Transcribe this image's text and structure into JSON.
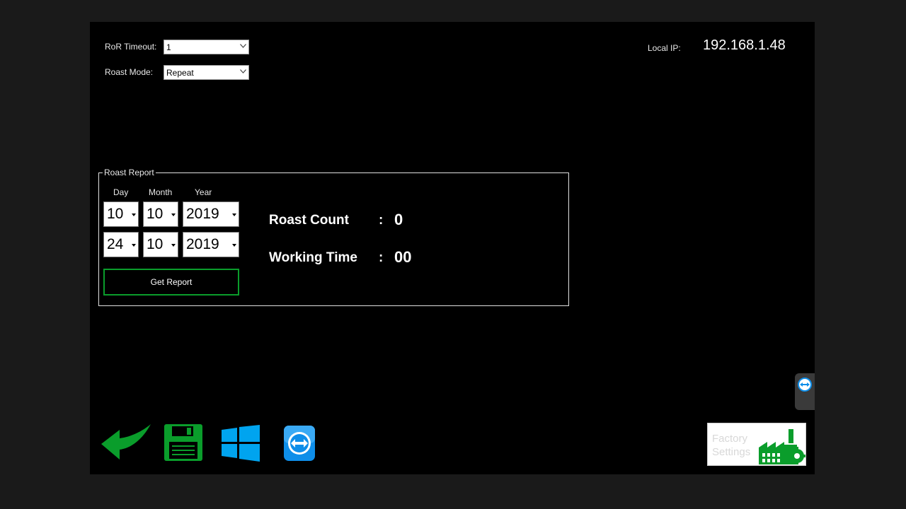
{
  "settings": {
    "ror_timeout_label": "RoR Timeout:",
    "ror_timeout_value": "1",
    "roast_mode_label": "Roast Mode:",
    "roast_mode_value": "Repeat"
  },
  "network": {
    "local_ip_label": "Local IP:",
    "local_ip_value": "192.168.1.48"
  },
  "report": {
    "group_title": "Roast Report",
    "headers": {
      "day": "Day",
      "month": "Month",
      "year": "Year"
    },
    "from_date": {
      "day": "10",
      "month": "10",
      "year": "2019"
    },
    "to_date": {
      "day": "24",
      "month": "10",
      "year": "2019"
    },
    "get_report_label": "Get Report",
    "roast_count_label": "Roast Count",
    "roast_count_value": "0",
    "working_time_label": "Working Time",
    "working_time_value": "00",
    "separator": ":"
  },
  "toolbar": {
    "icons": [
      "back-arrow-icon",
      "save-icon",
      "windows-icon",
      "teamviewer-icon"
    ]
  },
  "factory": {
    "label_line1": "Factory",
    "label_line2": "Settings",
    "icon": "factory-icon"
  },
  "colors": {
    "accent_green": "#0a9d2b",
    "windows_blue": "#00a4ef",
    "teamviewer_blue": "#0e8ee9",
    "background": "#000000"
  }
}
